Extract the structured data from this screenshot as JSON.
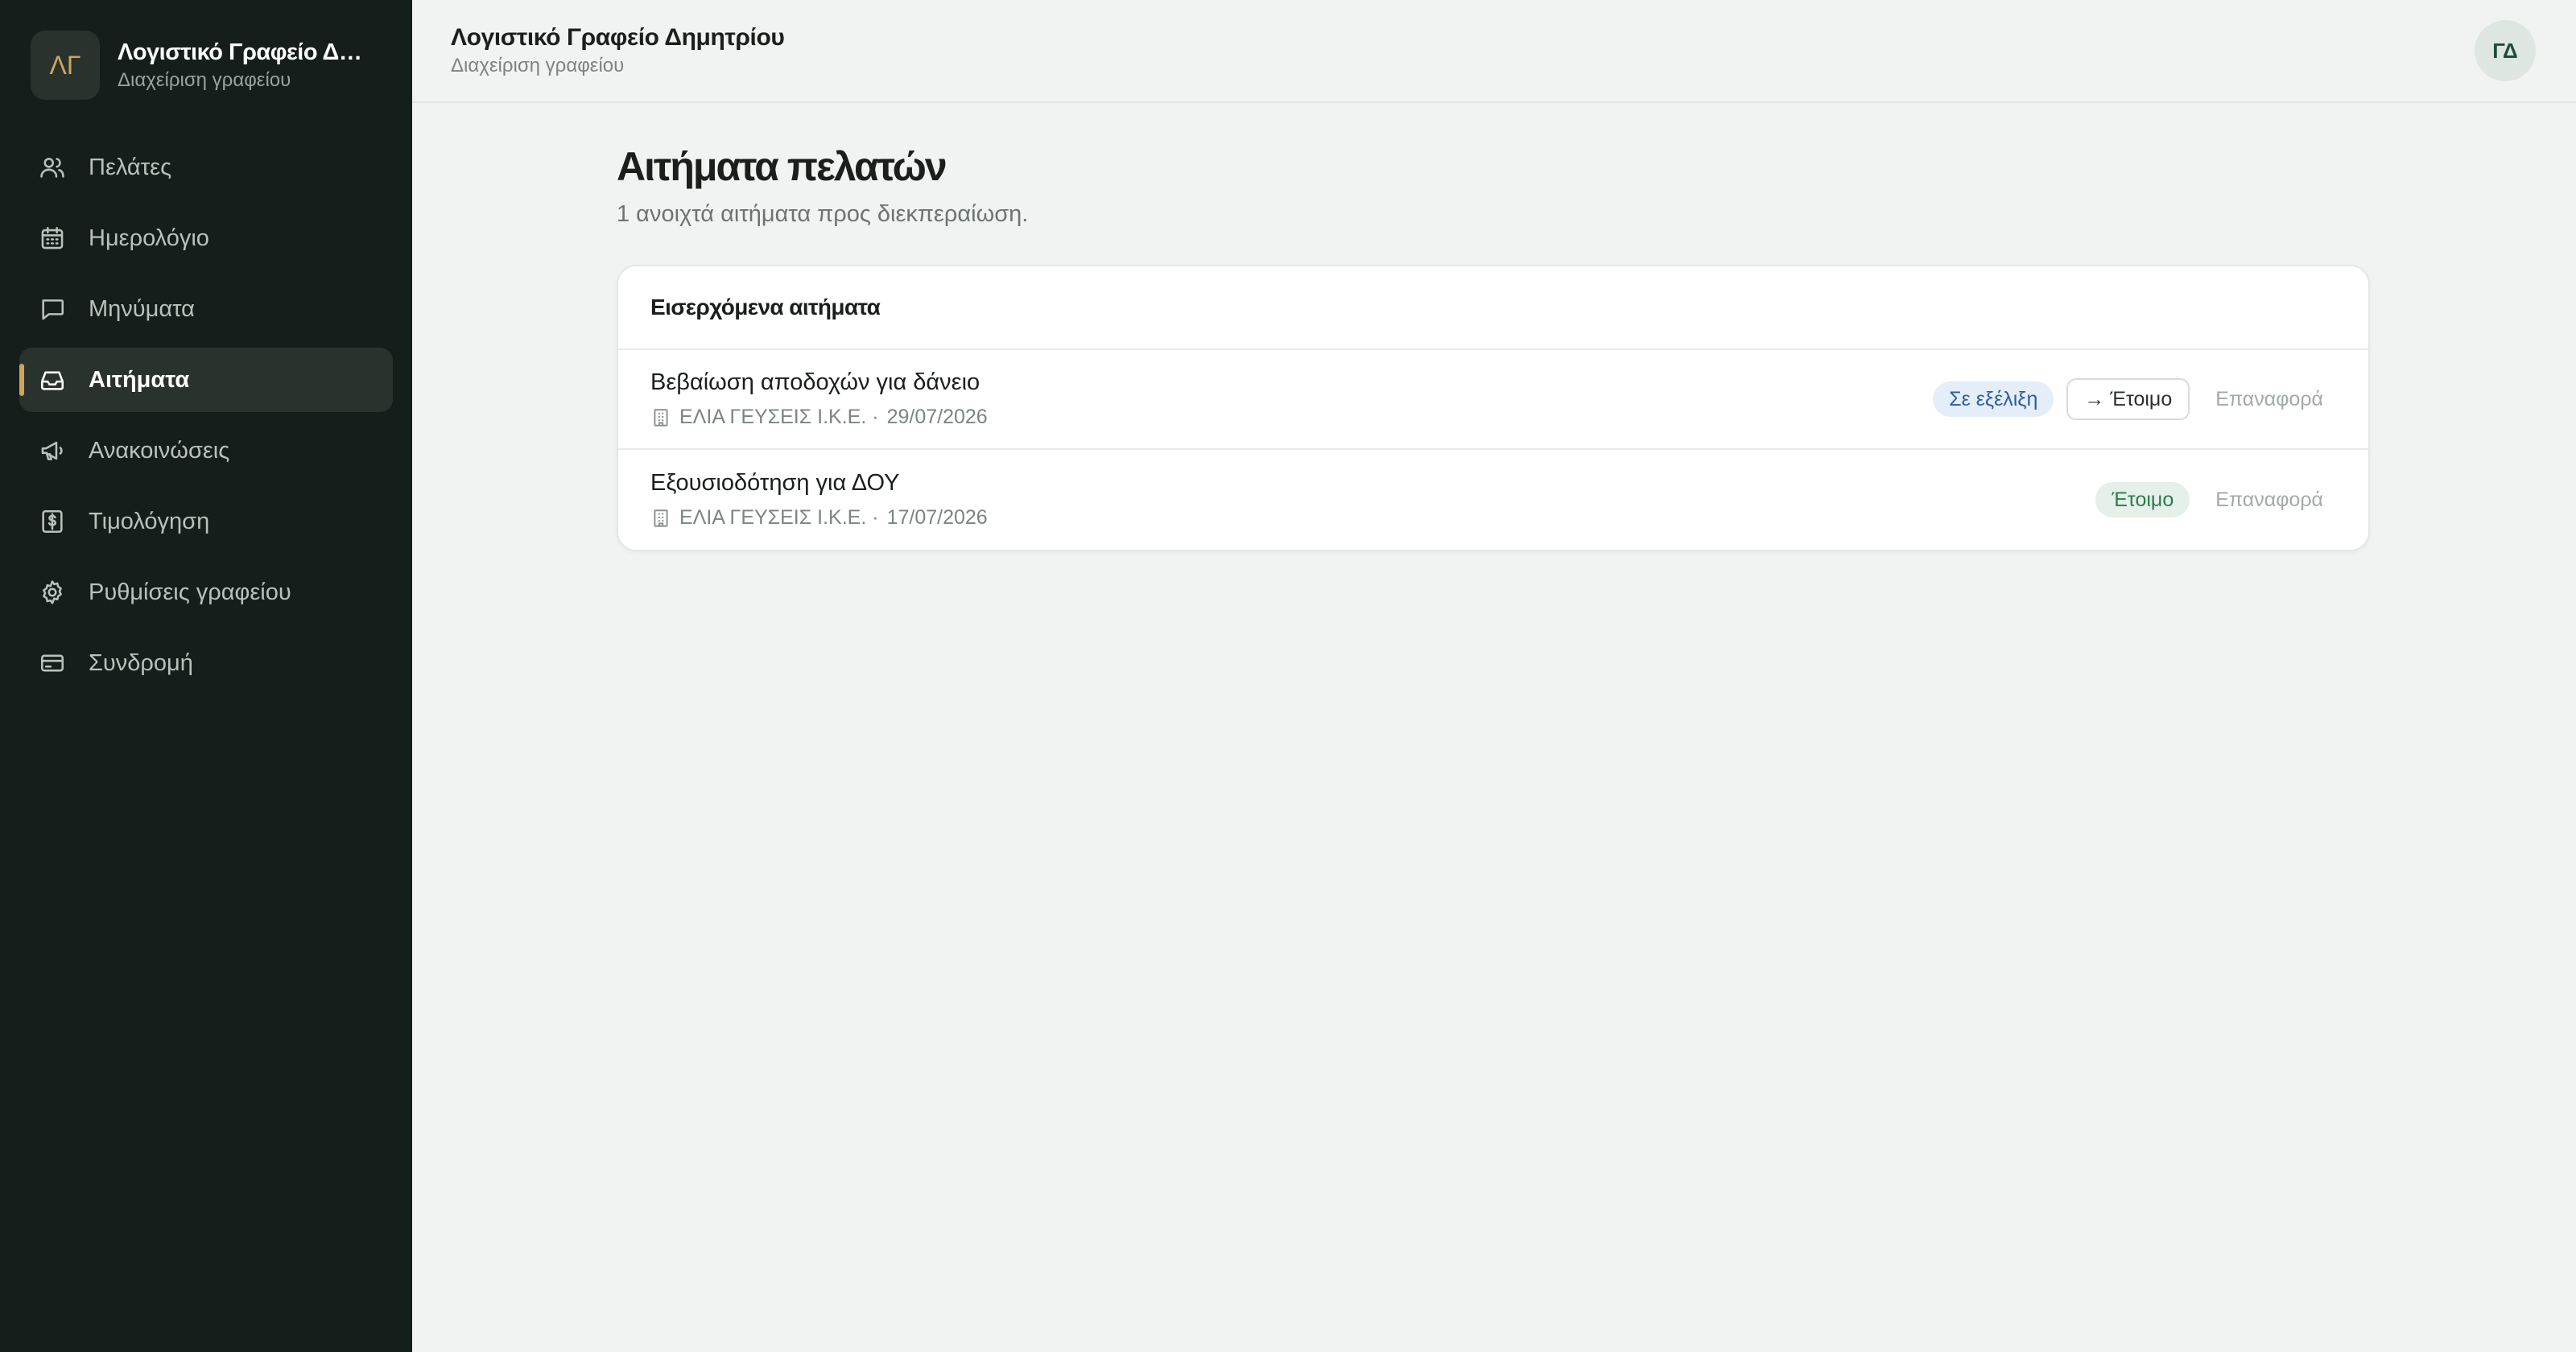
{
  "sidebar": {
    "logo": "ΛΓ",
    "brand_name": "Λογιστικό Γραφείο Δημητρίου",
    "brand_sub": "Διαχείριση γραφείου",
    "items": [
      {
        "label": "Πελάτες",
        "icon": "users-icon"
      },
      {
        "label": "Ημερολόγιο",
        "icon": "calendar-icon"
      },
      {
        "label": "Μηνύματα",
        "icon": "message-icon"
      },
      {
        "label": "Αιτήματα",
        "icon": "inbox-icon",
        "active": true
      },
      {
        "label": "Ανακοινώσεις",
        "icon": "megaphone-icon"
      },
      {
        "label": "Τιμολόγηση",
        "icon": "invoice-icon"
      },
      {
        "label": "Ρυθμίσεις γραφείου",
        "icon": "gear-icon"
      },
      {
        "label": "Συνδρομή",
        "icon": "credit-card-icon"
      }
    ]
  },
  "header": {
    "title": "Λογιστικό Γραφείο Δημητρίου",
    "subtitle": "Διαχείριση γραφείου",
    "avatar": "ΓΔ"
  },
  "page": {
    "title": "Αιτήματα πελατών",
    "subtitle": "1 ανοιχτά αιτήματα προς διεκπεραίωση."
  },
  "card": {
    "title": "Εισερχόμενα αιτήματα",
    "rows": [
      {
        "title": "Βεβαίωση αποδοχών για δάνειο",
        "client": "ΕΛΙΑ ΓΕΥΣΕΙΣ Ι.Κ.Ε. ·",
        "date": "29/07/2026",
        "status": "Σε εξέλιξη",
        "action": "→ Έτοιμο",
        "reset": "Επαναφορά"
      },
      {
        "title": "Εξουσιοδότηση για ΔΟΥ",
        "client": "ΕΛΙΑ ΓΕΥΣΕΙΣ Ι.Κ.Ε. ·",
        "date": "17/07/2026",
        "status": "Έτοιμο",
        "reset": "Επαναφορά"
      }
    ]
  },
  "colors": {
    "sidebar_bg": "#161e1b",
    "accent": "#d0a55a",
    "status_progress": "#2c5e9e",
    "status_ready": "#2d7a4e"
  }
}
